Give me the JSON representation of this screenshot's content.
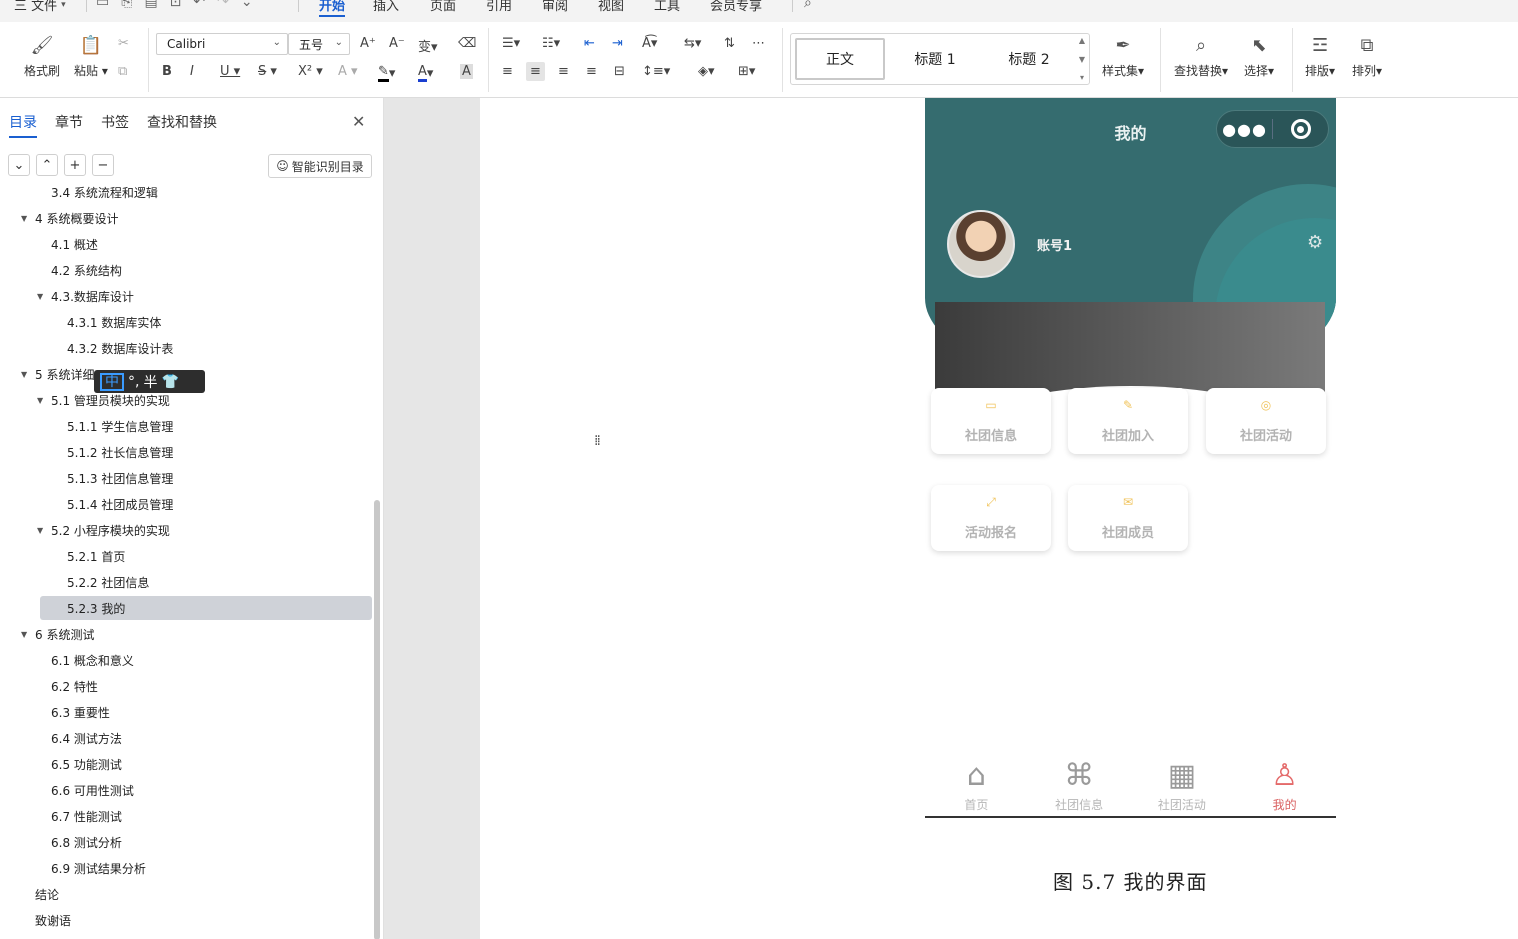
{
  "menu": {
    "file_label": "三 文件",
    "tabs": [
      "开始",
      "插入",
      "页面",
      "引用",
      "审阅",
      "视图",
      "工具",
      "会员专享"
    ],
    "active_tab": "开始"
  },
  "ribbon": {
    "format_painter": "格式刷",
    "paste": "粘贴",
    "font_name": "Calibri",
    "font_size": "五号",
    "styles": [
      "正文",
      "标题 1",
      "标题 2"
    ],
    "style_set": "样式集",
    "find_replace": "查找替换",
    "select": "选择",
    "layout": "排版",
    "arrange": "排列"
  },
  "nav": {
    "tabs": [
      "目录",
      "章节",
      "书签",
      "查找和替换"
    ],
    "active_tab": "目录",
    "smart_toc": "智能识别目录",
    "toc": [
      {
        "label": "3.4 系统流程和逻辑",
        "level": 2,
        "expanded": null
      },
      {
        "label": "4 系统概要设计",
        "level": 1,
        "expanded": true
      },
      {
        "label": "4.1 概述",
        "level": 2,
        "expanded": null
      },
      {
        "label": "4.2 系统结构",
        "level": 2,
        "expanded": null
      },
      {
        "label": "4.3.数据库设计",
        "level": 2,
        "expanded": true
      },
      {
        "label": "4.3.1 数据库实体",
        "level": 3,
        "expanded": null
      },
      {
        "label": "4.3.2 数据库设计表",
        "level": 3,
        "expanded": null
      },
      {
        "label": "5 系统详细",
        "level": 1,
        "expanded": true
      },
      {
        "label": "5.1  管理员模块的实现",
        "level": 2,
        "expanded": true
      },
      {
        "label": "5.1.1  学生信息管理",
        "level": 3,
        "expanded": null
      },
      {
        "label": "5.1.2  社长信息管理",
        "level": 3,
        "expanded": null
      },
      {
        "label": "5.1.3  社团信息管理",
        "level": 3,
        "expanded": null
      },
      {
        "label": "5.1.4  社团成员管理",
        "level": 3,
        "expanded": null
      },
      {
        "label": "5.2  小程序模块的实现",
        "level": 2,
        "expanded": true
      },
      {
        "label": "5.2.1  首页",
        "level": 3,
        "expanded": null
      },
      {
        "label": "5.2.2  社团信息",
        "level": 3,
        "expanded": null
      },
      {
        "label": "5.2.3  我的",
        "level": 3,
        "expanded": null,
        "selected": true
      },
      {
        "label": "6 系统测试",
        "level": 1,
        "expanded": true
      },
      {
        "label": "6.1 概念和意义",
        "level": 2,
        "expanded": null
      },
      {
        "label": "6.2 特性",
        "level": 2,
        "expanded": null
      },
      {
        "label": "6.3 重要性",
        "level": 2,
        "expanded": null
      },
      {
        "label": "6.4 测试方法",
        "level": 2,
        "expanded": null
      },
      {
        "label": "6.5  功能测试",
        "level": 2,
        "expanded": null
      },
      {
        "label": "6.6 可用性测试",
        "level": 2,
        "expanded": null
      },
      {
        "label": "6.7 性能测试",
        "level": 2,
        "expanded": null
      },
      {
        "label": "6.8 测试分析",
        "level": 2,
        "expanded": null
      },
      {
        "label": "6.9 测试结果分析",
        "level": 2,
        "expanded": null
      },
      {
        "label": "结论",
        "level": 1,
        "expanded": null
      },
      {
        "label": "致谢语",
        "level": 1,
        "expanded": null
      }
    ]
  },
  "ime": {
    "mode": "中",
    "punct": "°,",
    "width": "半"
  },
  "phone": {
    "title": "我的",
    "username": "账号1",
    "header_color": "#356c6f",
    "tiles": [
      "社团信息",
      "社团加入",
      "社团活动",
      "活动报名",
      "社团成员"
    ],
    "tabbar": [
      {
        "label": "首页",
        "icon": "home-icon"
      },
      {
        "label": "社团信息",
        "icon": "grid-icon"
      },
      {
        "label": "社团活动",
        "icon": "calendar-icon"
      },
      {
        "label": "我的",
        "icon": "user-icon",
        "active": true
      }
    ],
    "active_color": "#e46a6a"
  },
  "caption": "图 5.7  我的界面"
}
